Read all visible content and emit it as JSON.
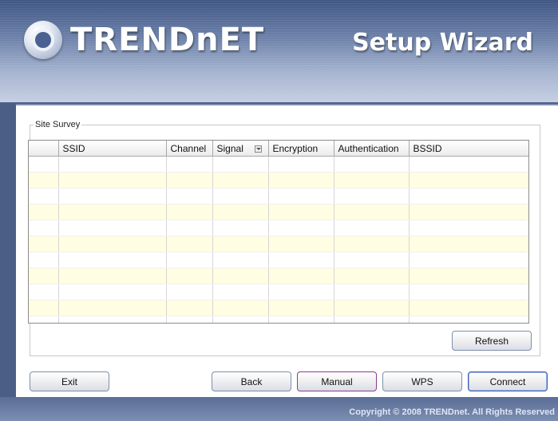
{
  "brand": {
    "logo_text": "TRENDnET",
    "wizard_title": "Setup Wizard"
  },
  "site_survey": {
    "group_label": "Site Survey",
    "columns": [
      "",
      "SSID",
      "Channel",
      "Signal",
      "Encryption",
      "Authentication",
      "BSSID"
    ],
    "rows": [],
    "refresh_label": "Refresh"
  },
  "buttons": {
    "exit": "Exit",
    "back": "Back",
    "manual": "Manual",
    "wps": "WPS",
    "connect": "Connect"
  },
  "footer": {
    "copyright": "Copyright © 2008 TRENDnet. All Rights Reserved"
  }
}
